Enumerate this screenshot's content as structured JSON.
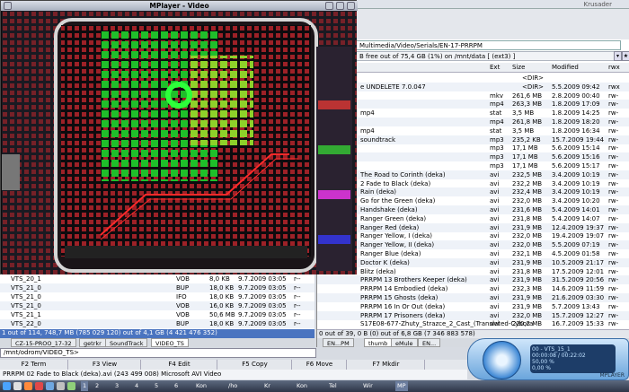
{
  "video_window": {
    "title": "MPlayer - Video",
    "behind_title": "Krusader"
  },
  "right_panel": {
    "path": "Multimedia/Video/Serials/EN-17-PRRPM",
    "free_space": "B free out of 75,4 GB (1%) on /mnt/data [ (ext3) ]",
    "columns": {
      "ext": "Ext",
      "size": "Size",
      "modified": "Modified",
      "rwx": "rwx"
    },
    "rows": [
      {
        "name": "",
        "ext": "",
        "size": "<DIR>",
        "modified": "",
        "rwx": ""
      },
      {
        "name": "e UNDELETE 7.0.047",
        "ext": "",
        "size": "<DIR>",
        "modified": "5.5.2009 09:42",
        "rwx": "rwx"
      },
      {
        "name": "",
        "ext": "mkv",
        "size": "261,6 MB",
        "modified": "2.8.2009 00:40",
        "rwx": "rw-"
      },
      {
        "name": "",
        "ext": "mp4",
        "size": "263,3 MB",
        "modified": "1.8.2009 17:09",
        "rwx": "rw-"
      },
      {
        "name": "mp4",
        "ext": "stat",
        "size": "3,5 MB",
        "modified": "1.8.2009 14:25",
        "rwx": "rw-"
      },
      {
        "name": "",
        "ext": "mp4",
        "size": "261,8 MB",
        "modified": "1.8.2009 18:20",
        "rwx": "rw-"
      },
      {
        "name": "mp4",
        "ext": "stat",
        "size": "3,5 MB",
        "modified": "1.8.2009 16:34",
        "rwx": "rw-"
      },
      {
        "name": "soundtrack",
        "ext": "mp3",
        "size": "235,2 KB",
        "modified": "15.7.2009 19:44",
        "rwx": "rw-"
      },
      {
        "name": "",
        "ext": "mp3",
        "size": "17,1 MB",
        "modified": "5.6.2009 15:14",
        "rwx": "rw-"
      },
      {
        "name": "",
        "ext": "mp3",
        "size": "17,1 MB",
        "modified": "5.6.2009 15:16",
        "rwx": "rw-"
      },
      {
        "name": "",
        "ext": "mp3",
        "size": "17,1 MB",
        "modified": "5.6.2009 15:17",
        "rwx": "rw-"
      },
      {
        "name": "The Road to Corinth (deka)",
        "ext": "avi",
        "size": "232,5 MB",
        "modified": "3.4.2009 10:19",
        "rwx": "rw-"
      },
      {
        "name": "2 Fade to Black (deka)",
        "ext": "avi",
        "size": "232,2 MB",
        "modified": "3.4.2009 10:19",
        "rwx": "rw-"
      },
      {
        "name": "Rain (deka)",
        "ext": "avi",
        "size": "232,4 MB",
        "modified": "3.4.2009 10:19",
        "rwx": "rw-"
      },
      {
        "name": "Go for the Green (deka)",
        "ext": "avi",
        "size": "232,0 MB",
        "modified": "3.4.2009 10:20",
        "rwx": "rw-"
      },
      {
        "name": "Handshake (deka)",
        "ext": "avi",
        "size": "231,6 MB",
        "modified": "5.4.2009 14:01",
        "rwx": "rw-"
      },
      {
        "name": "Ranger Green (deka)",
        "ext": "avi",
        "size": "231,8 MB",
        "modified": "5.4.2009 14:07",
        "rwx": "rw-"
      },
      {
        "name": "Ranger Red (deka)",
        "ext": "avi",
        "size": "231,9 MB",
        "modified": "12.4.2009 19:37",
        "rwx": "rw-"
      },
      {
        "name": "Ranger Yellow, I (deka)",
        "ext": "avi",
        "size": "232,0 MB",
        "modified": "19.4.2009 19:07",
        "rwx": "rw-"
      },
      {
        "name": "Ranger Yellow, II (deka)",
        "ext": "avi",
        "size": "232,0 MB",
        "modified": "5.5.2009 07:19",
        "rwx": "rw-"
      },
      {
        "name": "Ranger Blue (deka)",
        "ext": "avi",
        "size": "232,1 MB",
        "modified": "4.5.2009 01:58",
        "rwx": "rw-"
      },
      {
        "name": "Doctor K (deka)",
        "ext": "avi",
        "size": "231,9 MB",
        "modified": "10.5.2009 21:17",
        "rwx": "rw-"
      },
      {
        "name": "Blitz (deka)",
        "ext": "avi",
        "size": "231,8 MB",
        "modified": "17.5.2009 12:01",
        "rwx": "rw-"
      },
      {
        "name": "PRRPM 13 Brothers Keeper (deka)",
        "ext": "avi",
        "size": "231,9 MB",
        "modified": "31.5.2009 20:56",
        "rwx": "rw-"
      },
      {
        "name": "PRRPM 14 Embodied (deka)",
        "ext": "avi",
        "size": "232,3 MB",
        "modified": "14.6.2009 11:59",
        "rwx": "rw-"
      },
      {
        "name": "PRRPM 15 Ghosts (deka)",
        "ext": "avi",
        "size": "231,9 MB",
        "modified": "21.6.2009 03:30",
        "rwx": "rw-"
      },
      {
        "name": "PRRPM 16 In Or Out (deka)",
        "ext": "avi",
        "size": "231,9 MB",
        "modified": "5.7.2009 13:43",
        "rwx": "rw-"
      },
      {
        "name": "PRRPM 17 Prisoners (deka)",
        "ext": "avi",
        "size": "232,0 MB",
        "modified": "15.7.2009 12:27",
        "rwx": "rw-"
      },
      {
        "name": "S17E08-677-Zhuty_Strazce_2_Cast_(Translated-Cybora",
        "ext": "avi",
        "size": "220,2 MB",
        "modified": "16.7.2009 15:33",
        "rwx": "rw-"
      }
    ],
    "status": "0 out of 39, 0 B (0) out of 6,8 GB (7 346 883 578)",
    "tabs": [
      "EN...PM",
      "thumb",
      "eMule",
      "EN..."
    ]
  },
  "left_panel": {
    "rows": [
      {
        "name": "VTS_20_1",
        "ext": "VOB",
        "size": "8,0 KB",
        "modified": "9.7.2009 03:05",
        "rwx": "r--"
      },
      {
        "name": "VTS_21_0",
        "ext": "BUP",
        "size": "18,0 KB",
        "modified": "9.7.2009 03:05",
        "rwx": "r--"
      },
      {
        "name": "VTS_21_0",
        "ext": "IFO",
        "size": "18,0 KB",
        "modified": "9.7.2009 03:05",
        "rwx": "r--"
      },
      {
        "name": "VTS_21_0",
        "ext": "VOB",
        "size": "16,0 KB",
        "modified": "9.7.2009 03:05",
        "rwx": "r--"
      },
      {
        "name": "VTS_21_1",
        "ext": "VOB",
        "size": "50,6 MB",
        "modified": "9.7.2009 03:05",
        "rwx": "r--"
      },
      {
        "name": "VTS_22_0",
        "ext": "BUP",
        "size": "18,0 KB",
        "modified": "9.7.2009 03:05",
        "rwx": "r--"
      }
    ],
    "status": "1 out of 114, 748,7 MB (785 029 120) out of 4,1 GB (4 421 476 352)",
    "tabs": [
      "CZ-15-PROO_17-32",
      "getrkr",
      "SoundTrack",
      "VIDEO_TS"
    ]
  },
  "command_line": "/mnt/odrom/VIDEO_TS>",
  "function_keys": [
    "F2 Term",
    "F3 View",
    "F4 Edit",
    "F5 Copy",
    "F6 Move",
    "F7 Mkdir"
  ],
  "info_bar": "PRRPM 02 Fade to Black (deka).avi  (243 499 008)  Microsoft AVI Video",
  "taskbar": {
    "desktops": [
      "1",
      "2",
      "3",
      "4",
      "5",
      "6"
    ],
    "tasks": [
      "Kon",
      "/ho",
      "Kr",
      "Kon",
      "Tel",
      "Wir",
      "MP"
    ]
  },
  "media_player": {
    "track": "00 - VTS_15_1",
    "elapsed": "00:00:08 / 00:22:02",
    "volume": "50,00 %",
    "balance": "0,00 %",
    "name": "MPLAYER"
  }
}
